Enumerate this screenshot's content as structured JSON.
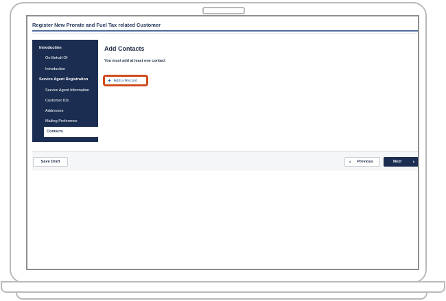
{
  "app": {
    "title": "Register New Prorate and Fuel Tax related Customer"
  },
  "sidebar": {
    "items": [
      {
        "label": "Introduction",
        "kind": "section"
      },
      {
        "label": "On Behalf Of",
        "kind": "sub"
      },
      {
        "label": "Introduction",
        "kind": "sub"
      },
      {
        "label": "Service Agent Registration",
        "kind": "section"
      },
      {
        "label": "Service Agent Information",
        "kind": "sub"
      },
      {
        "label": "Customer IDs",
        "kind": "sub"
      },
      {
        "label": "Addresses",
        "kind": "sub"
      },
      {
        "label": "Mailing Preference",
        "kind": "sub"
      },
      {
        "label": "Contacts",
        "kind": "sub",
        "active": true
      }
    ]
  },
  "main": {
    "heading": "Add Contacts",
    "note": "You must add at least one contact",
    "add_record_label": "Add a Record"
  },
  "footer": {
    "save_draft_label": "Save Draft",
    "previous_label": "Previous",
    "next_label": "Next"
  },
  "icons": {
    "add": "plus-icon",
    "previous": "chevron-left-icon",
    "next": "chevron-right-icon"
  },
  "colors": {
    "sidebar_bg": "#1b2e51",
    "accent_link": "#2d5b9a",
    "highlight": "#cf4b1c"
  }
}
